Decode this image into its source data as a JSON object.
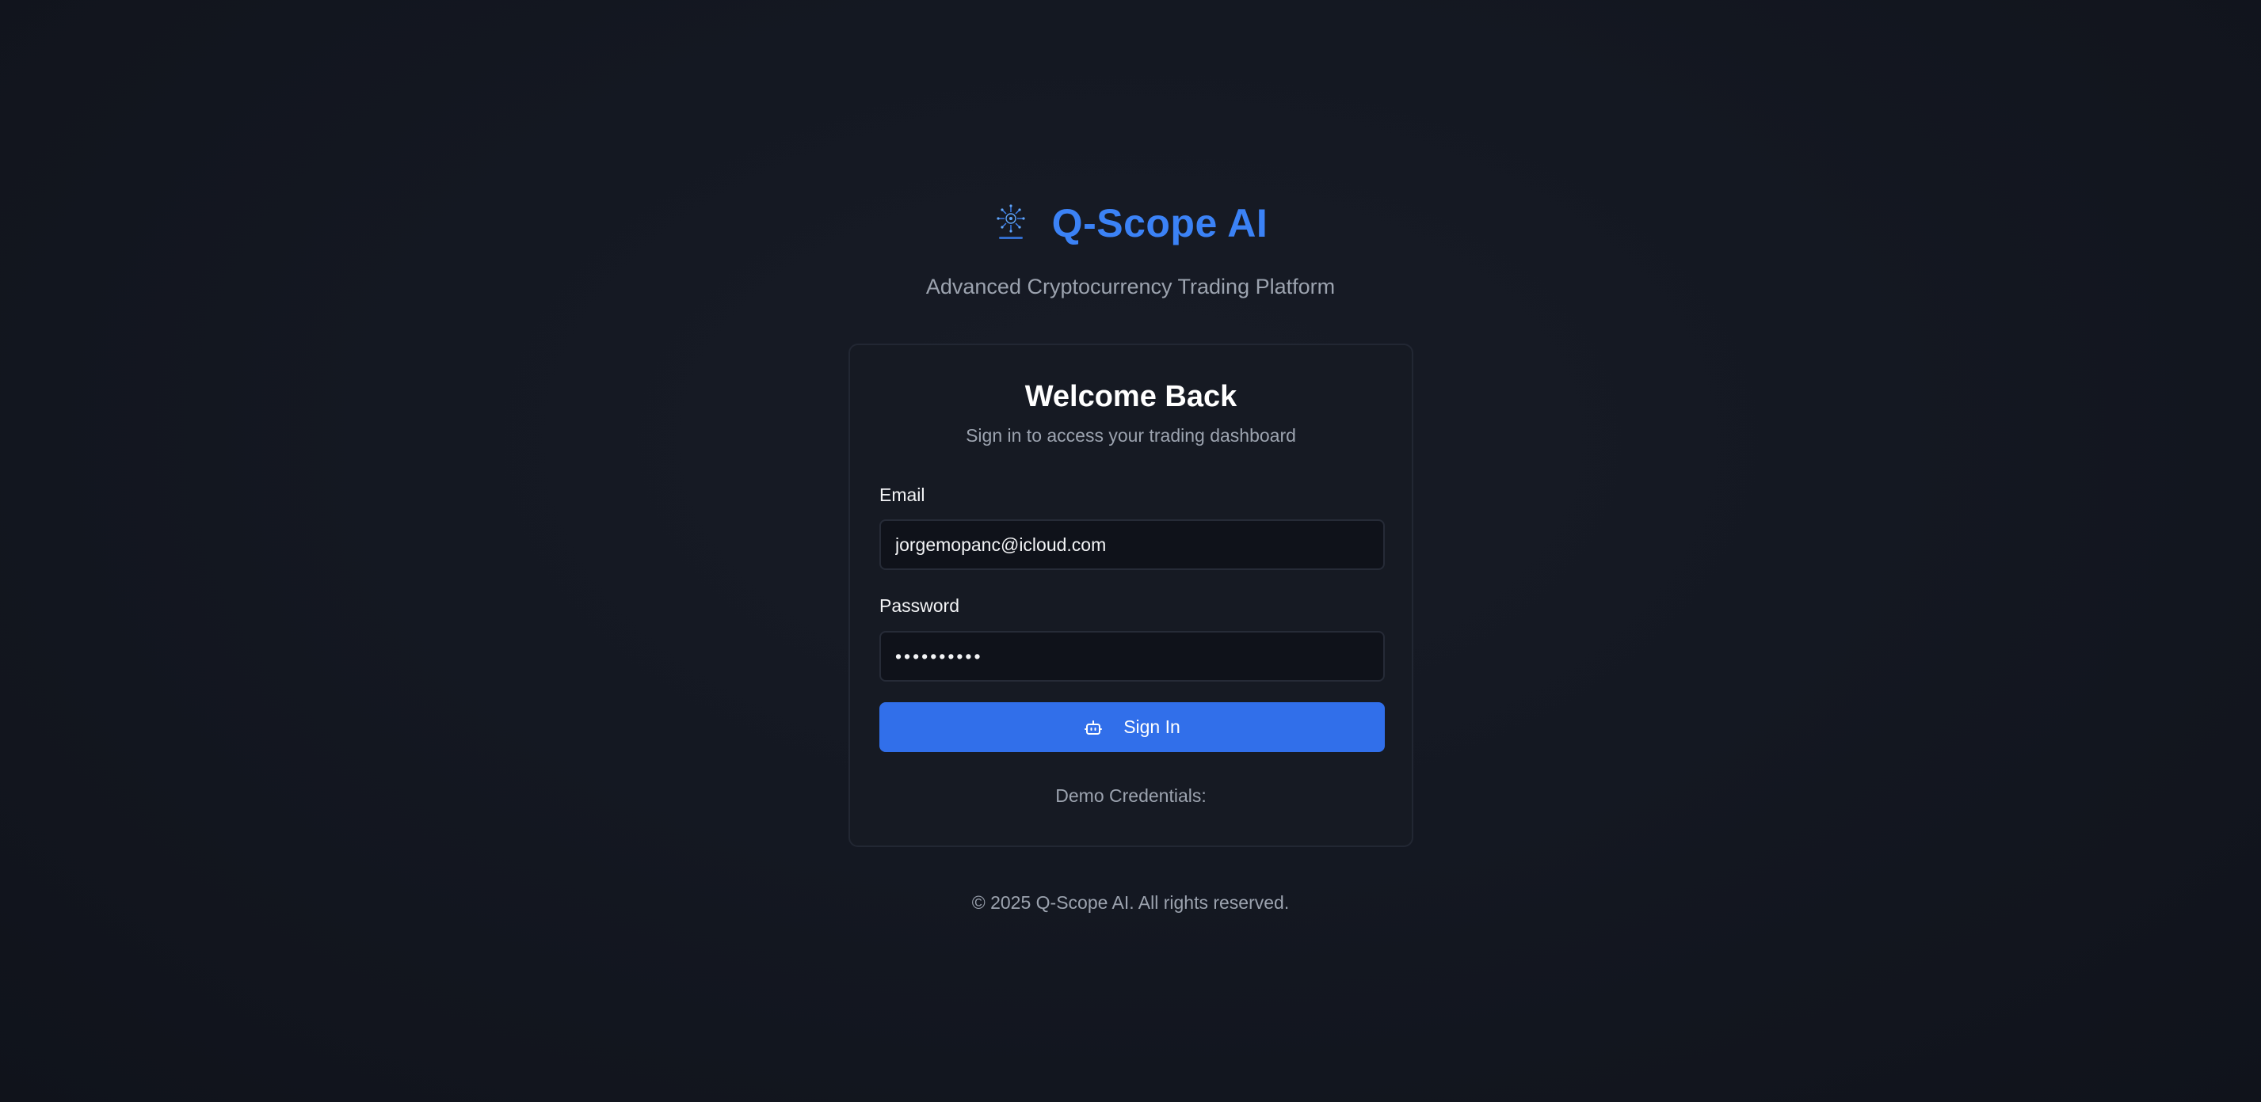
{
  "brand": {
    "title": "Q-Scope AI",
    "subtitle": "Advanced Cryptocurrency Trading Platform",
    "logo_icon": "qscope-logo-icon",
    "accent_color": "#3b82f6"
  },
  "login_card": {
    "title": "Welcome Back",
    "subtitle": "Sign in to access your trading dashboard",
    "email": {
      "label": "Email",
      "value": "jorgemopanc@icloud.com"
    },
    "password": {
      "label": "Password",
      "value": "••••••••••"
    },
    "signin_button": {
      "label": "Sign In",
      "icon": "bot-icon",
      "color": "#316fea"
    },
    "demo_credentials_label": "Demo Credentials:"
  },
  "footer": {
    "copyright": "© 2025 Q-Scope AI. All rights reserved."
  }
}
